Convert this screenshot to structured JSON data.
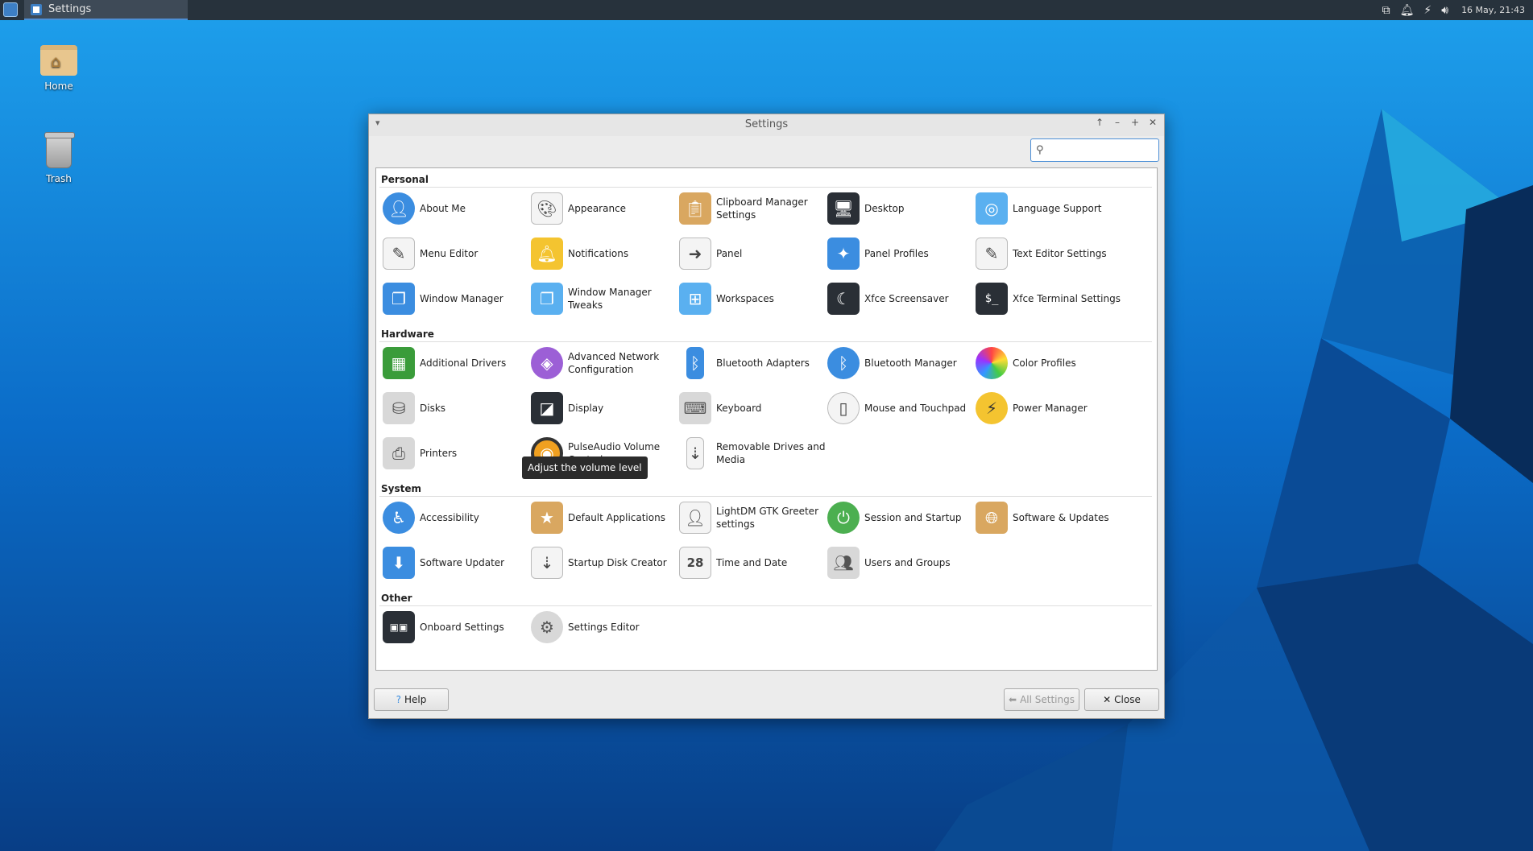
{
  "taskbar": {
    "task_title": "Settings",
    "clock": "16 May, 21:43",
    "tray_icons": [
      "network-icon",
      "bell-icon",
      "power-icon",
      "volume-icon"
    ]
  },
  "desktop": {
    "icons": [
      {
        "label": "Home"
      },
      {
        "label": "Trash"
      }
    ]
  },
  "window": {
    "title": "Settings",
    "search_placeholder": "",
    "sections": {
      "personal": {
        "title": "Personal",
        "items": [
          {
            "label": "About Me",
            "icon": "user-icon"
          },
          {
            "label": "Appearance",
            "icon": "palette-icon"
          },
          {
            "label": "Clipboard Manager Settings",
            "icon": "clipboard-icon"
          },
          {
            "label": "Desktop",
            "icon": "monitor-icon"
          },
          {
            "label": "Language Support",
            "icon": "language-icon"
          },
          {
            "label": "Menu Editor",
            "icon": "menu-editor-icon"
          },
          {
            "label": "Notifications",
            "icon": "bell-icon"
          },
          {
            "label": "Panel",
            "icon": "panel-icon"
          },
          {
            "label": "Panel Profiles",
            "icon": "panel-profiles-icon"
          },
          {
            "label": "Text Editor Settings",
            "icon": "text-editor-icon"
          },
          {
            "label": "Window Manager",
            "icon": "window-manager-icon"
          },
          {
            "label": "Window Manager Tweaks",
            "icon": "wm-tweaks-icon"
          },
          {
            "label": "Workspaces",
            "icon": "workspaces-icon"
          },
          {
            "label": "Xfce Screensaver",
            "icon": "screensaver-icon"
          },
          {
            "label": "Xfce Terminal Settings",
            "icon": "terminal-icon"
          }
        ]
      },
      "hardware": {
        "title": "Hardware",
        "items": [
          {
            "label": "Additional Drivers",
            "icon": "chip-icon"
          },
          {
            "label": "Advanced Network Configuration",
            "icon": "network-icon"
          },
          {
            "label": "Bluetooth Adapters",
            "icon": "bluetooth-adapter-icon"
          },
          {
            "label": "Bluetooth Manager",
            "icon": "bluetooth-icon"
          },
          {
            "label": "Color Profiles",
            "icon": "color-icon"
          },
          {
            "label": "Disks",
            "icon": "disk-icon"
          },
          {
            "label": "Display",
            "icon": "display-icon"
          },
          {
            "label": "Keyboard",
            "icon": "keyboard-icon"
          },
          {
            "label": "Mouse and Touchpad",
            "icon": "mouse-icon"
          },
          {
            "label": "Power Manager",
            "icon": "power-icon"
          },
          {
            "label": "Printers",
            "icon": "printer-icon"
          },
          {
            "label": "PulseAudio Volume Control",
            "icon": "speaker-icon"
          },
          {
            "label": "Removable Drives and Media",
            "icon": "usb-icon"
          }
        ]
      },
      "system": {
        "title": "System",
        "items": [
          {
            "label": "Accessibility",
            "icon": "accessibility-icon"
          },
          {
            "label": "Default Applications",
            "icon": "default-apps-icon"
          },
          {
            "label": "LightDM GTK Greeter settings",
            "icon": "login-icon"
          },
          {
            "label": "Session and Startup",
            "icon": "session-icon"
          },
          {
            "label": "Software & Updates",
            "icon": "software-icon"
          },
          {
            "label": "Software Updater",
            "icon": "updater-icon"
          },
          {
            "label": "Startup Disk Creator",
            "icon": "usb-creator-icon"
          },
          {
            "label": "Time and Date",
            "icon": "calendar-icon"
          },
          {
            "label": "Users and Groups",
            "icon": "users-icon"
          }
        ]
      },
      "other": {
        "title": "Other",
        "items": [
          {
            "label": "Onboard Settings",
            "icon": "onboard-icon"
          },
          {
            "label": "Settings Editor",
            "icon": "gear-icon"
          }
        ]
      }
    },
    "tooltip": "Adjust the volume level",
    "buttons": {
      "help": "Help",
      "all_settings": "All Settings",
      "close": "Close"
    }
  }
}
